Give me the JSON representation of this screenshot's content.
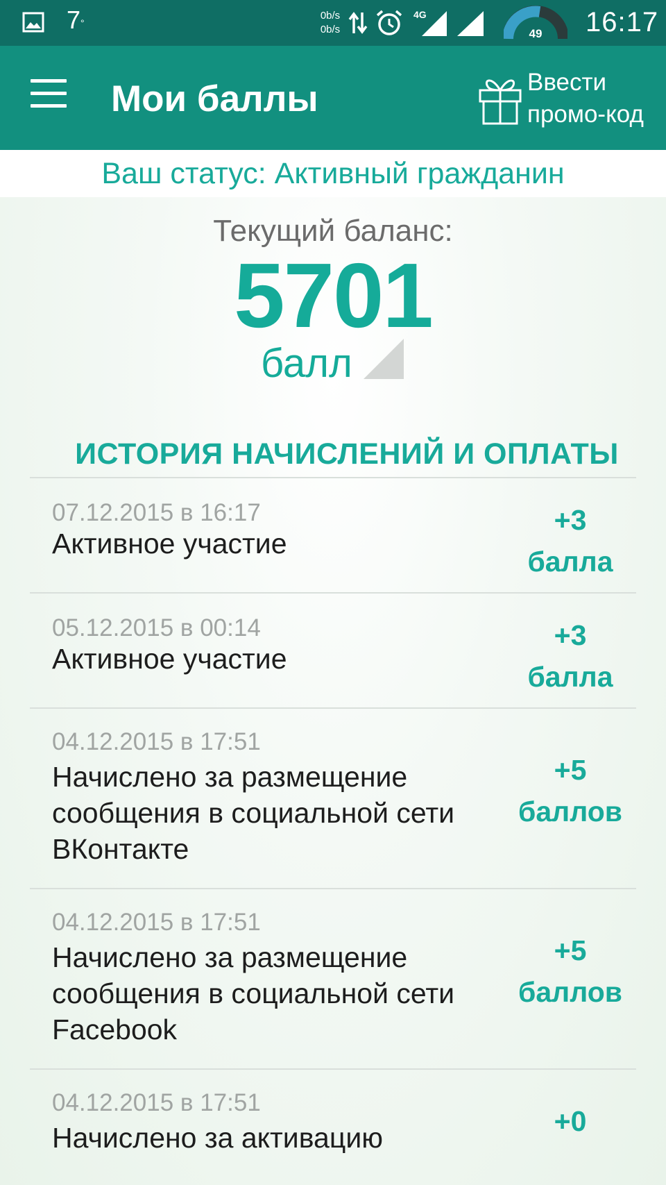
{
  "status_bar": {
    "temperature": "7",
    "temperature_unit": "°",
    "net_up": "0b/s",
    "net_down": "0b/s",
    "network_type": "4G",
    "speed_gauge_value": "49",
    "time": "16:17",
    "icons": [
      "gallery-icon",
      "data-arrows-icon",
      "alarm-icon",
      "signal-4g-icon",
      "signal-icon",
      "speed-gauge-icon"
    ]
  },
  "app_bar": {
    "title": "Мои баллы",
    "promo_label": "Ввести\nпромо-код",
    "icons": [
      "menu-icon",
      "gift-icon"
    ]
  },
  "status": {
    "text": "Ваш статус: Активный гражданин"
  },
  "balance": {
    "label": "Текущий баланс:",
    "value": "5701",
    "unit": "балл"
  },
  "history": {
    "title": "ИСТОРИЯ НАЧИСЛЕНИЙ И ОПЛАТЫ",
    "items": [
      {
        "date": "07.12.2015 в 16:17",
        "description": "Активное участие",
        "amount": "+3",
        "unit": "балла"
      },
      {
        "date": "05.12.2015 в 00:14",
        "description": "Активное участие",
        "amount": "+3",
        "unit": "балла"
      },
      {
        "date": "04.12.2015 в 17:51",
        "description": "Начислено за размещение сообщения в социальной сети ВКонтакте",
        "amount": "+5",
        "unit": "баллов"
      },
      {
        "date": "04.12.2015 в 17:51",
        "description": "Начислено за размещение сообщения в социальной сети Facebook",
        "amount": "+5",
        "unit": "баллов"
      },
      {
        "date": "04.12.2015 в 17:51",
        "description": "Начислено за активацию",
        "amount": "+0",
        "unit": ""
      }
    ]
  },
  "colors": {
    "status_bar": "#0f6e64",
    "app_bar": "#12907f",
    "accent": "#18aa9a",
    "text": "#1d1d1d",
    "muted": "#a0a4a2"
  }
}
